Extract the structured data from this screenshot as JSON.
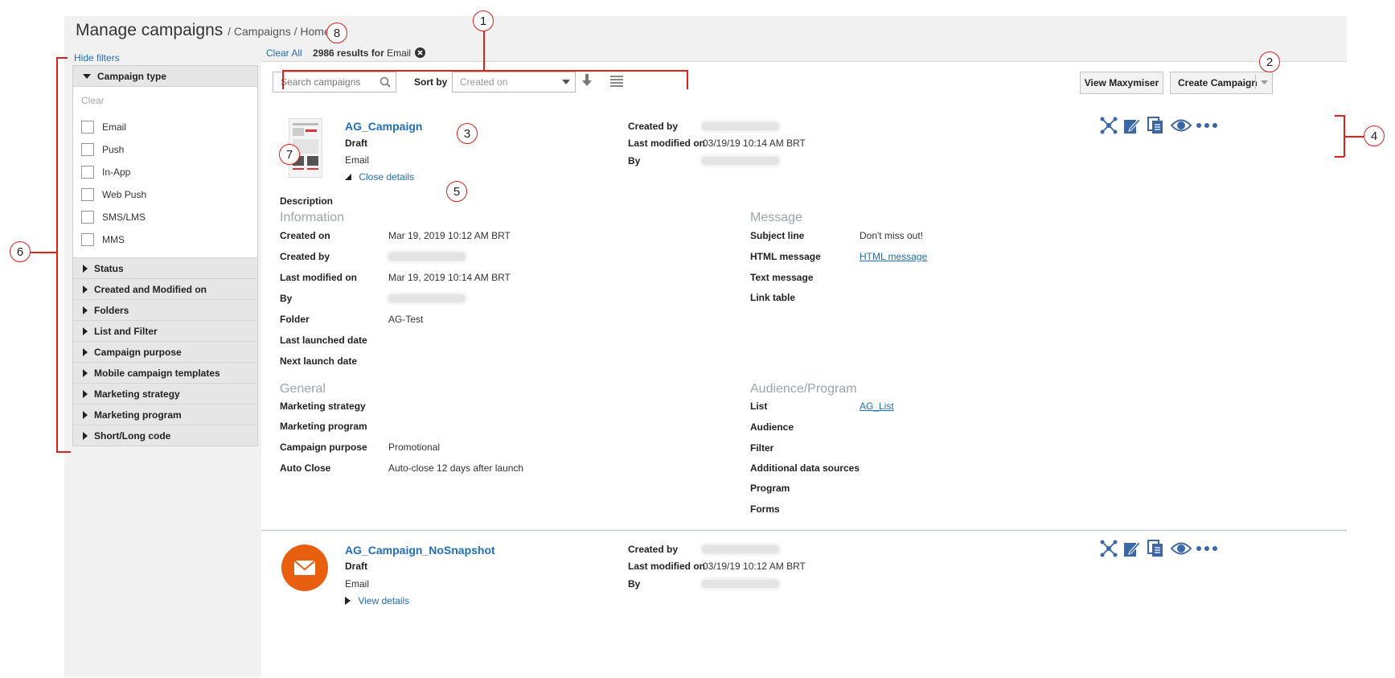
{
  "header": {
    "title": "Manage campaigns",
    "breadcrumb": "/ Campaigns / Home"
  },
  "filters": {
    "hide_label": "Hide filters",
    "campaign_type": {
      "label": "Campaign type",
      "clear_label": "Clear",
      "options": [
        "Email",
        "Push",
        "In-App",
        "Web Push",
        "SMS/LMS",
        "MMS"
      ]
    },
    "sections": [
      "Status",
      "Created and Modified on",
      "Folders",
      "List and Filter",
      "Campaign purpose",
      "Mobile campaign templates",
      "Marketing strategy",
      "Marketing program",
      "Short/Long code"
    ]
  },
  "results": {
    "clear_all": "Clear All",
    "summary": "2986 results for",
    "term": "Email"
  },
  "toolbar": {
    "search_placeholder": "Search campaigns",
    "sort_label": "Sort by",
    "sort_value": "Created on",
    "view_maxymiser": "View Maxymiser",
    "create_campaign": "Create Campaign"
  },
  "campaigns": [
    {
      "name": "AG_Campaign",
      "status": "Draft",
      "channel": "Email",
      "toggle_label": "Close details",
      "meta": {
        "created_by_label": "Created by",
        "last_modified_label": "Last modified on",
        "last_modified_value": "03/19/19 10:14 AM BRT",
        "by_label": "By"
      },
      "description_label": "Description",
      "information": {
        "title": "Information",
        "rows": [
          {
            "label": "Created on",
            "value": "Mar 19, 2019 10:12 AM BRT"
          },
          {
            "label": "Created by",
            "value": ""
          },
          {
            "label": "Last modified on",
            "value": "Mar 19, 2019 10:14 AM BRT"
          },
          {
            "label": "By",
            "value": ""
          },
          {
            "label": "Folder",
            "value": "AG-Test"
          },
          {
            "label": "Last launched date",
            "value": ""
          },
          {
            "label": "Next launch date",
            "value": ""
          }
        ]
      },
      "message": {
        "title": "Message",
        "rows": [
          {
            "label": "Subject line",
            "value": "Don't miss out!"
          },
          {
            "label": "HTML message",
            "value": "HTML message"
          },
          {
            "label": "Text message",
            "value": ""
          },
          {
            "label": "Link table",
            "value": ""
          }
        ]
      },
      "general": {
        "title": "General",
        "rows": [
          {
            "label": "Marketing strategy",
            "value": ""
          },
          {
            "label": "Marketing program",
            "value": ""
          },
          {
            "label": "Campaign purpose",
            "value": "Promotional"
          },
          {
            "label": "Auto Close",
            "value": "Auto-close 12 days after launch"
          }
        ]
      },
      "audience": {
        "title": "Audience/Program",
        "rows": [
          {
            "label": "List",
            "value": "AG_List"
          },
          {
            "label": "Audience",
            "value": ""
          },
          {
            "label": "Filter",
            "value": ""
          },
          {
            "label": "Additional data sources",
            "value": ""
          },
          {
            "label": "Program",
            "value": ""
          },
          {
            "label": "Forms",
            "value": ""
          }
        ]
      }
    },
    {
      "name": "AG_Campaign_NoSnapshot",
      "status": "Draft",
      "channel": "Email",
      "toggle_label": "View details",
      "meta": {
        "created_by_label": "Created by",
        "last_modified_label": "Last modified on",
        "last_modified_value": "03/19/19 10:12 AM BRT",
        "by_label": "By"
      }
    }
  ],
  "annotations": [
    "1",
    "2",
    "3",
    "4",
    "5",
    "6",
    "7",
    "8"
  ],
  "colors": {
    "link": "#1f6fbd",
    "icon": "#3b67a8",
    "annotation": "#e0201a",
    "email_icon_bg": "#e8600f"
  }
}
